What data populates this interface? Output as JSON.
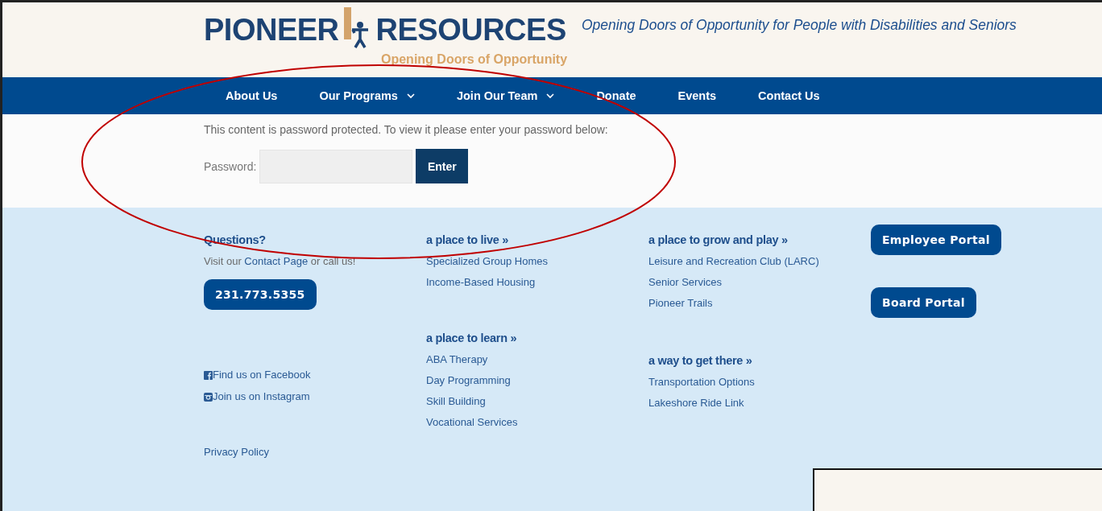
{
  "header": {
    "logo": {
      "word_left": "PIONEER",
      "word_right": "RESOURCES",
      "subtitle": "Opening Doors of Opportunity"
    },
    "tagline": "Opening Doors of Opportunity for People with Disabilities and Seniors"
  },
  "nav": [
    {
      "label": "About Us",
      "dropdown": false
    },
    {
      "label": "Our Programs",
      "dropdown": true
    },
    {
      "label": "Join Our Team",
      "dropdown": true
    },
    {
      "label": "Donate",
      "dropdown": false
    },
    {
      "label": "Events",
      "dropdown": false
    },
    {
      "label": "Contact Us",
      "dropdown": false
    }
  ],
  "password_form": {
    "message": "This content is password protected. To view it please enter your password below:",
    "label": "Password:",
    "button": "Enter"
  },
  "footer": {
    "contact": {
      "heading": "Questions?",
      "text_before": "Visit our ",
      "link": "Contact Page",
      "text_after": " or call us!",
      "phone": "231.773.5355",
      "social": [
        {
          "kind": "facebook",
          "label": "Find us on Facebook"
        },
        {
          "kind": "instagram",
          "label": "Join us on Instagram"
        }
      ],
      "privacy": "Privacy Policy"
    },
    "columns": [
      [
        {
          "heading": "a place to live »",
          "links": [
            "Specialized Group Homes",
            "Income-Based Housing"
          ]
        },
        {
          "heading": "a place to learn »",
          "links": [
            "ABA Therapy",
            "Day Programming",
            "Skill Building",
            "Vocational Services"
          ]
        }
      ],
      [
        {
          "heading": "a place to grow and play »",
          "links": [
            "Leisure and Recreation Club (LARC)",
            "Senior Services",
            "Pioneer Trails"
          ]
        },
        {
          "heading": "a way to get there »",
          "links": [
            "Transportation Options",
            "Lakeshore Ride Link"
          ]
        }
      ]
    ],
    "portals": [
      "Employee Portal",
      "Board Portal"
    ]
  }
}
